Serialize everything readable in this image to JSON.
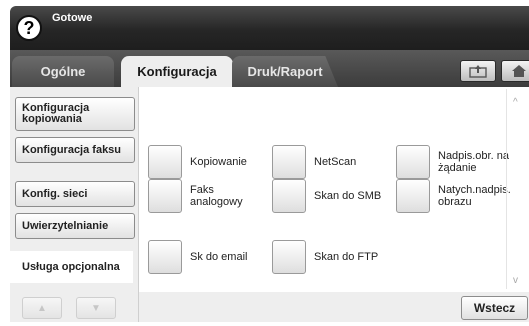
{
  "status": {
    "text": "Gotowe"
  },
  "help": {
    "glyph": "?"
  },
  "tabs": [
    {
      "label": "Ogólne"
    },
    {
      "label": "Konfiguracja"
    },
    {
      "label": "Druk/Raport"
    }
  ],
  "toolbar": {
    "upload_icon": "upload-icon",
    "home_icon": "home-icon"
  },
  "left_menu": {
    "items": [
      {
        "label": "Konfiguracja kopiowania"
      },
      {
        "label": "Konfiguracja faksu"
      },
      {
        "label": "Konfig. sieci"
      },
      {
        "label": "Uwierzytelnianie"
      },
      {
        "label": "Usługa opcjonalna"
      }
    ],
    "arrow_up": "▲",
    "arrow_down": "▼"
  },
  "options": [
    {
      "label": "Kopiowanie"
    },
    {
      "label": "NetScan"
    },
    {
      "label": "Nadpis.obr. na żądanie"
    },
    {
      "label": "Faks analogowy"
    },
    {
      "label": "Skan do SMB"
    },
    {
      "label": "Natych.nadpis. obrazu"
    },
    {
      "label": "Sk do email"
    },
    {
      "label": "Skan do FTP"
    }
  ],
  "scroll": {
    "up": "^",
    "down": "v"
  },
  "footer": {
    "back_label": "Wstecz"
  }
}
